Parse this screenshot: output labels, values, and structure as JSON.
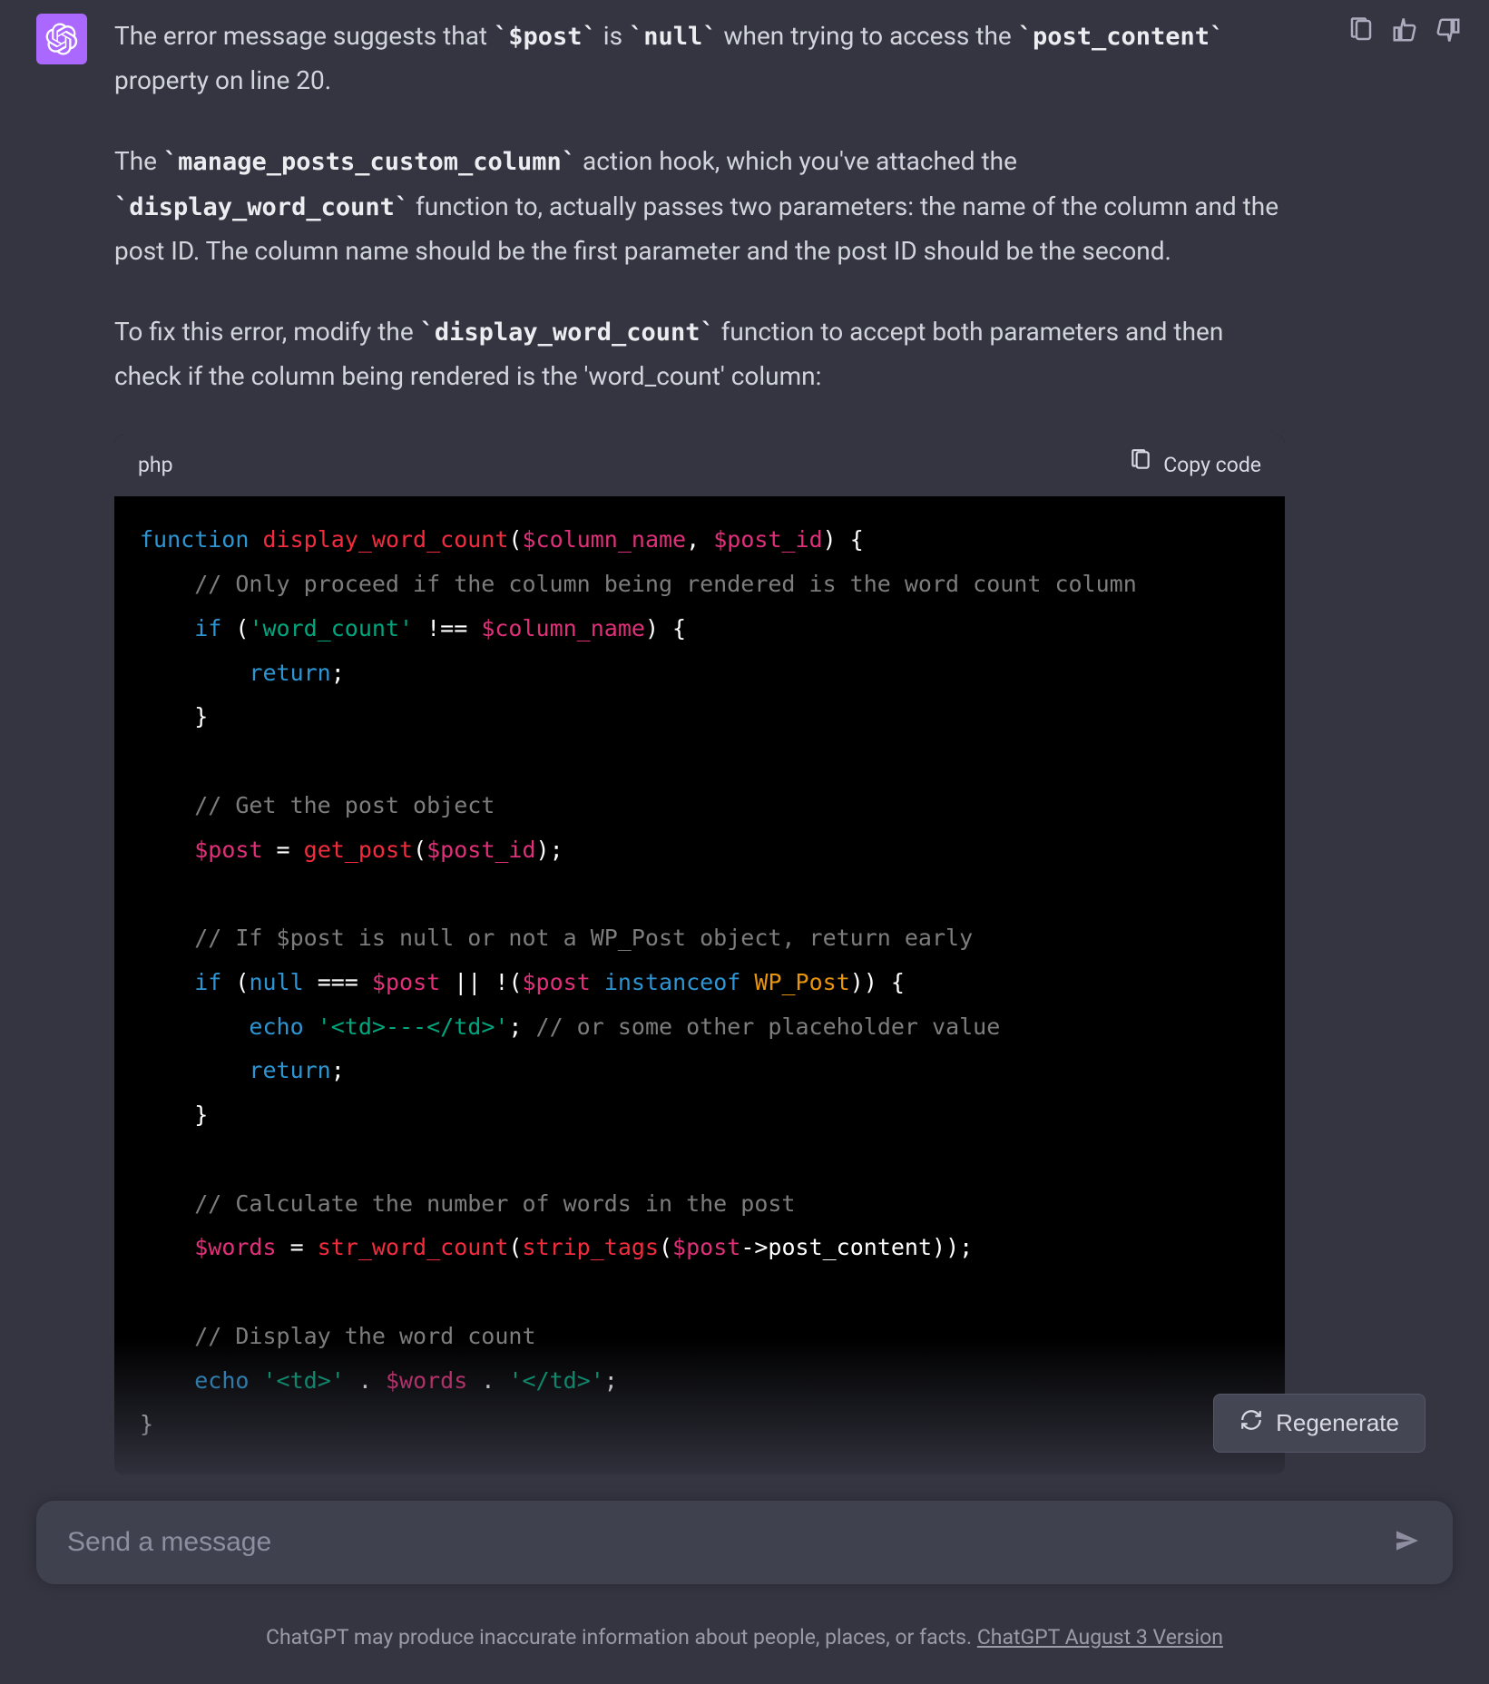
{
  "paragraphs": {
    "p1_a": "The error message suggests that ",
    "p1_code1": "`$post`",
    "p1_b": " is ",
    "p1_code2": "`null`",
    "p1_c": " when trying to access the ",
    "p1_code3": "`post_content`",
    "p1_d": " property on line 20.",
    "p2_a": "The ",
    "p2_code1": "`manage_posts_custom_column`",
    "p2_b": " action hook, which you've attached the ",
    "p2_code2": "`display_word_count`",
    "p2_c": " function to, actually passes two parameters: the name of the column and the post ID. The column name should be the first parameter and the post ID should be the second.",
    "p3_a": "To fix this error, modify the ",
    "p3_code1": "`display_word_count`",
    "p3_b": " function to accept both parameters and then check if the column being rendered is the 'word_count' column:"
  },
  "codeblock": {
    "language": "php",
    "copy_label": "Copy code",
    "tokens": [
      {
        "t": "function",
        "c": "kw"
      },
      {
        "t": " ",
        "c": "pl"
      },
      {
        "t": "display_word_count",
        "c": "fn"
      },
      {
        "t": "(",
        "c": "pl"
      },
      {
        "t": "$column_name",
        "c": "var"
      },
      {
        "t": ", ",
        "c": "pl"
      },
      {
        "t": "$post_id",
        "c": "var"
      },
      {
        "t": ") {",
        "c": "pl"
      },
      {
        "t": "\n",
        "c": "pl"
      },
      {
        "t": "    ",
        "c": "pl"
      },
      {
        "t": "// Only proceed if the column being rendered is the word count column",
        "c": "cm"
      },
      {
        "t": "\n",
        "c": "pl"
      },
      {
        "t": "    ",
        "c": "pl"
      },
      {
        "t": "if",
        "c": "kw"
      },
      {
        "t": " (",
        "c": "pl"
      },
      {
        "t": "'word_count'",
        "c": "str"
      },
      {
        "t": " !== ",
        "c": "pl"
      },
      {
        "t": "$column_name",
        "c": "var"
      },
      {
        "t": ") {",
        "c": "pl"
      },
      {
        "t": "\n",
        "c": "pl"
      },
      {
        "t": "        ",
        "c": "pl"
      },
      {
        "t": "return",
        "c": "kw"
      },
      {
        "t": ";",
        "c": "pl"
      },
      {
        "t": "\n",
        "c": "pl"
      },
      {
        "t": "    }",
        "c": "pl"
      },
      {
        "t": "\n",
        "c": "pl"
      },
      {
        "t": "\n",
        "c": "pl"
      },
      {
        "t": "    ",
        "c": "pl"
      },
      {
        "t": "// Get the post object",
        "c": "cm"
      },
      {
        "t": "\n",
        "c": "pl"
      },
      {
        "t": "    ",
        "c": "pl"
      },
      {
        "t": "$post",
        "c": "var"
      },
      {
        "t": " = ",
        "c": "pl"
      },
      {
        "t": "get_post",
        "c": "fn"
      },
      {
        "t": "(",
        "c": "pl"
      },
      {
        "t": "$post_id",
        "c": "var"
      },
      {
        "t": ");",
        "c": "pl"
      },
      {
        "t": "\n",
        "c": "pl"
      },
      {
        "t": "\n",
        "c": "pl"
      },
      {
        "t": "    ",
        "c": "pl"
      },
      {
        "t": "// If $post is null or not a WP_Post object, return early",
        "c": "cm"
      },
      {
        "t": "\n",
        "c": "pl"
      },
      {
        "t": "    ",
        "c": "pl"
      },
      {
        "t": "if",
        "c": "kw"
      },
      {
        "t": " (",
        "c": "pl"
      },
      {
        "t": "null",
        "c": "kw"
      },
      {
        "t": " === ",
        "c": "pl"
      },
      {
        "t": "$post",
        "c": "var"
      },
      {
        "t": " || !(",
        "c": "pl"
      },
      {
        "t": "$post",
        "c": "var"
      },
      {
        "t": " ",
        "c": "pl"
      },
      {
        "t": "instanceof",
        "c": "kw"
      },
      {
        "t": " ",
        "c": "pl"
      },
      {
        "t": "WP_Post",
        "c": "cls"
      },
      {
        "t": ")) {",
        "c": "pl"
      },
      {
        "t": "\n",
        "c": "pl"
      },
      {
        "t": "        ",
        "c": "pl"
      },
      {
        "t": "echo",
        "c": "kw"
      },
      {
        "t": " ",
        "c": "pl"
      },
      {
        "t": "'<td>---</td>'",
        "c": "str"
      },
      {
        "t": "; ",
        "c": "pl"
      },
      {
        "t": "// or some other placeholder value",
        "c": "cm"
      },
      {
        "t": "\n",
        "c": "pl"
      },
      {
        "t": "        ",
        "c": "pl"
      },
      {
        "t": "return",
        "c": "kw"
      },
      {
        "t": ";",
        "c": "pl"
      },
      {
        "t": "\n",
        "c": "pl"
      },
      {
        "t": "    }",
        "c": "pl"
      },
      {
        "t": "\n",
        "c": "pl"
      },
      {
        "t": "\n",
        "c": "pl"
      },
      {
        "t": "    ",
        "c": "pl"
      },
      {
        "t": "// Calculate the number of words in the post",
        "c": "cm"
      },
      {
        "t": "\n",
        "c": "pl"
      },
      {
        "t": "    ",
        "c": "pl"
      },
      {
        "t": "$words",
        "c": "var"
      },
      {
        "t": " = ",
        "c": "pl"
      },
      {
        "t": "str_word_count",
        "c": "fn"
      },
      {
        "t": "(",
        "c": "pl"
      },
      {
        "t": "strip_tags",
        "c": "fn"
      },
      {
        "t": "(",
        "c": "pl"
      },
      {
        "t": "$post",
        "c": "var"
      },
      {
        "t": "->post_content));",
        "c": "pl"
      },
      {
        "t": "\n",
        "c": "pl"
      },
      {
        "t": "\n",
        "c": "pl"
      },
      {
        "t": "    ",
        "c": "pl"
      },
      {
        "t": "// Display the word count",
        "c": "cm"
      },
      {
        "t": "\n",
        "c": "pl"
      },
      {
        "t": "    ",
        "c": "pl"
      },
      {
        "t": "echo",
        "c": "kw"
      },
      {
        "t": " ",
        "c": "pl"
      },
      {
        "t": "'<td>'",
        "c": "str"
      },
      {
        "t": " . ",
        "c": "pl"
      },
      {
        "t": "$words",
        "c": "var"
      },
      {
        "t": " . ",
        "c": "pl"
      },
      {
        "t": "'</td>'",
        "c": "str"
      },
      {
        "t": ";",
        "c": "pl"
      },
      {
        "t": "\n",
        "c": "pl"
      },
      {
        "t": "}",
        "c": "pl"
      }
    ]
  },
  "regen_label": "Regenerate",
  "input_placeholder": "Send a message",
  "footer_text": "ChatGPT may produce inaccurate information about people, places, or facts. ",
  "footer_link": "ChatGPT August 3 Version"
}
